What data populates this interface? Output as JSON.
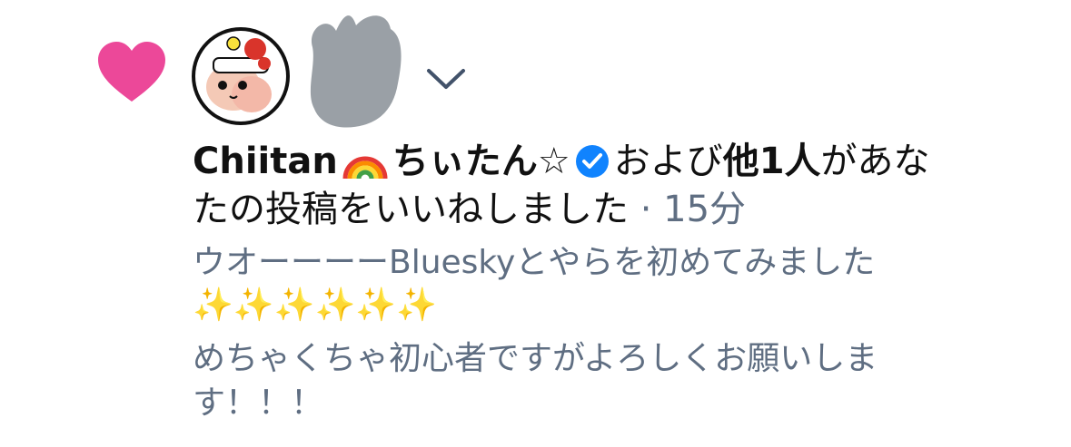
{
  "notification": {
    "type": "like",
    "icon": "heart-icon",
    "actor_name": "Chiitan",
    "actor_suffix": "ちぃたん☆",
    "and_text": "および",
    "others_count": "他1人",
    "tail_line1": "があな",
    "line2_main": "たの投稿をいいねしました",
    "time_sep": "·",
    "time": "15分"
  },
  "post": {
    "line1": "ウオーーーーBlueskyとやらを初めてみました",
    "sparkles": "✨✨✨✨✨✨",
    "line3": "めちゃくちゃ初心者ですがよろしくお願いしま",
    "line4": "す！！！"
  },
  "colors": {
    "heart": "#ec4899",
    "verified": "#1083fe",
    "muted_text": "#5f6e82",
    "text": "#111111"
  }
}
